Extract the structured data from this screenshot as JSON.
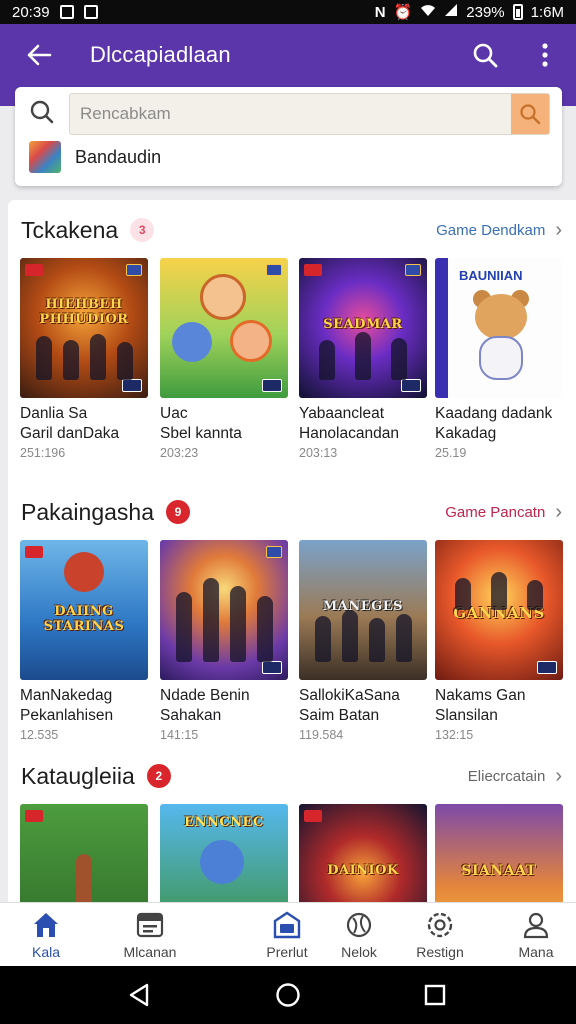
{
  "status_bar": {
    "time_left": "20:39",
    "battery": "239%",
    "clock": "1:6M"
  },
  "app_bar": {
    "title": "Dlccapiadlaan",
    "back_icon": "arrow-left-icon",
    "search_icon": "search-icon",
    "more_icon": "more-vertical-icon"
  },
  "search": {
    "placeholder": "Rencabkam",
    "suggestion": "Bandaudin"
  },
  "sections": [
    {
      "title": "Tckakena",
      "badge": "3",
      "link": "Game Dendkam",
      "link_color": "#3b6fb6",
      "items": [
        {
          "name1": "Danlia Sa",
          "name2": "Garil danDaka",
          "count": "251:196",
          "poster": "HIEHBEH PHHUDIOR"
        },
        {
          "name1": "Uac",
          "name2": "Sbel kannta",
          "count": "203:23",
          "poster": ""
        },
        {
          "name1": "Yabaancleat",
          "name2": "Hanolacandan",
          "count": "203:13",
          "poster": "SEADMAR"
        },
        {
          "name1": "Kaadang dadank",
          "name2": "Kakadag",
          "count": "25.19",
          "poster": "BAUNIIAN"
        }
      ]
    },
    {
      "title": "Pakaingasha",
      "badge": "9",
      "link": "Game Pancatn",
      "link_color": "#c0254c",
      "items": [
        {
          "name1": "ManNakedag",
          "name2": "Pekanlahisen",
          "count": "12.535",
          "poster": "DAIING STARINAS"
        },
        {
          "name1": "Ndade Benin",
          "name2": "Sahakan",
          "count": "141:15",
          "poster": ""
        },
        {
          "name1": "SallokiKaSana",
          "name2": "Saim Batan",
          "count": "119.584",
          "poster": "MANEGES"
        },
        {
          "name1": "Nakams Gan",
          "name2": "Slansilan",
          "count": "132:15",
          "poster": "GANNANS"
        }
      ]
    },
    {
      "title": "Kataugleiia",
      "badge": "2",
      "link": "Eliecrcatain",
      "link_color": "#666666",
      "items": [
        {
          "poster": ""
        },
        {
          "poster": "ENNCNEC"
        },
        {
          "poster": "DAINIOK"
        },
        {
          "poster": "SIANAAT"
        }
      ]
    }
  ],
  "bottom_nav": [
    {
      "label": "Kala",
      "icon": "home-icon"
    },
    {
      "label": "Mlcanan",
      "icon": "calendar-icon"
    },
    {
      "label": "Prerlut",
      "icon": "store-icon"
    },
    {
      "label": "Nelok",
      "icon": "globe-icon"
    },
    {
      "label": "Restign",
      "icon": "settings-icon"
    },
    {
      "label": "Mana",
      "icon": "profile-icon"
    }
  ],
  "colors": {
    "brand": "#5b36ab",
    "active_nav": "#2a4fb0"
  }
}
